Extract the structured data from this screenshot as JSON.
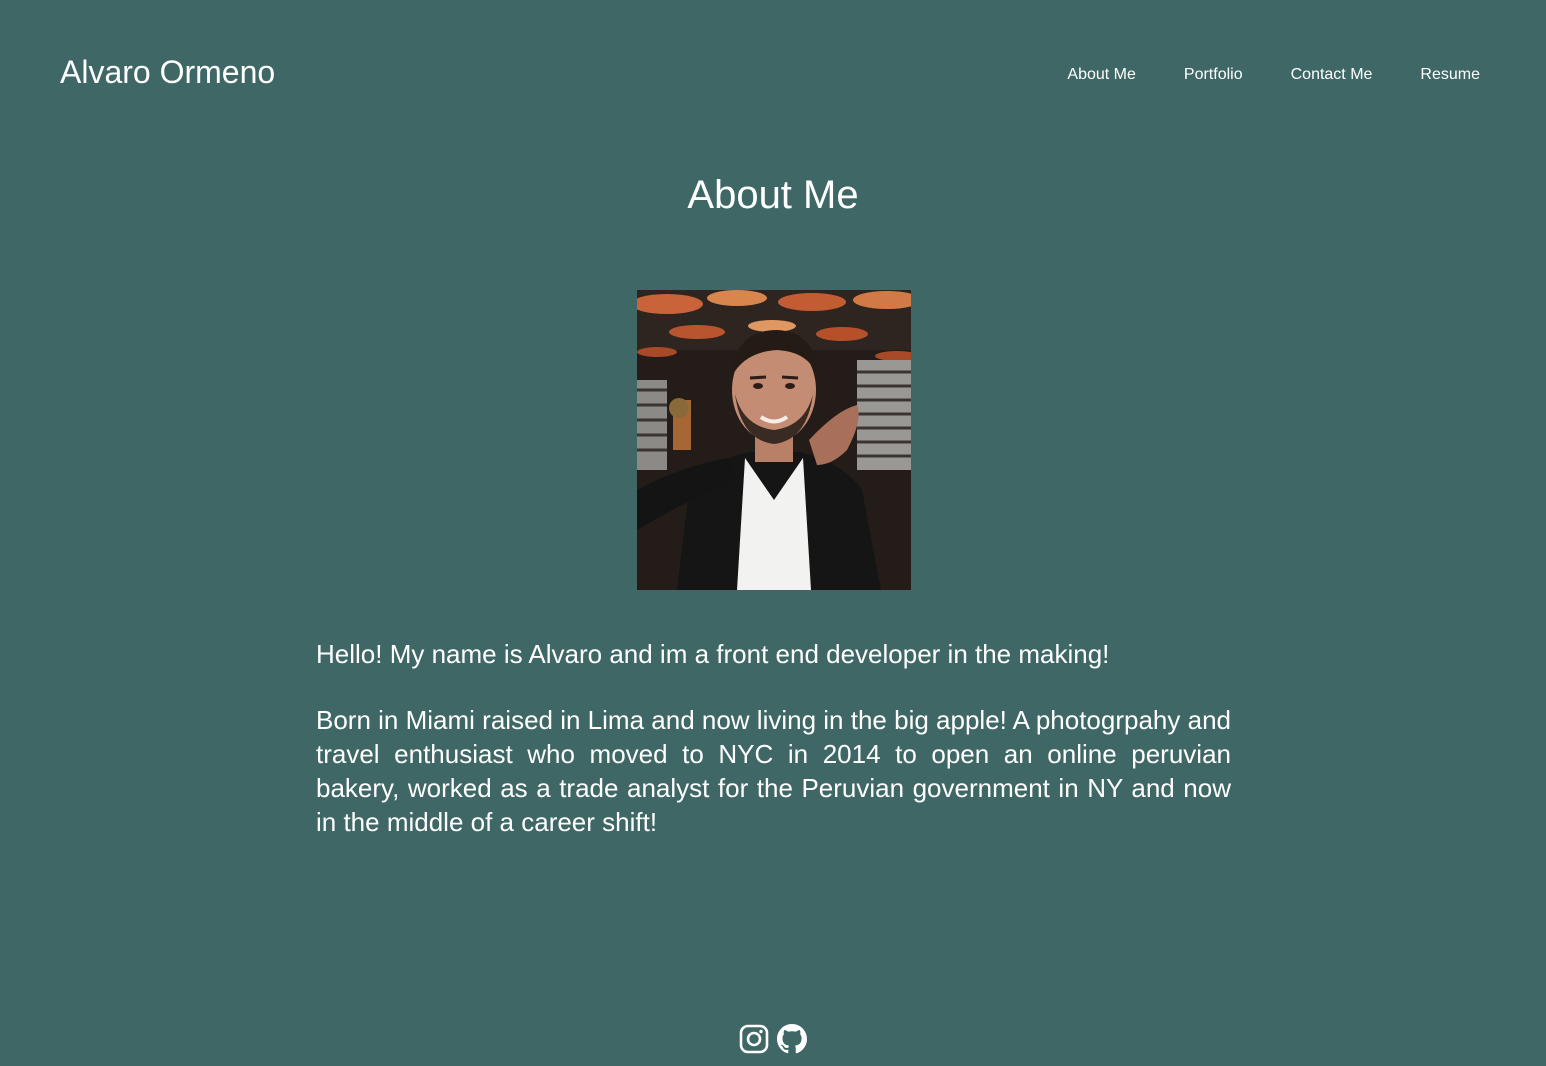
{
  "header": {
    "brand": "Alvaro Ormeno",
    "nav": [
      {
        "label": "About Me"
      },
      {
        "label": "Portfolio"
      },
      {
        "label": "Contact Me"
      },
      {
        "label": "Resume"
      }
    ]
  },
  "main": {
    "title": "About Me",
    "photo": {
      "icon": "profile-photo"
    },
    "paragraphs": [
      "Hello! My name is Alvaro and im a front end developer in the making!",
      "Born in Miami raised in Lima and now living in the big apple! A photogrpahy and travel enthusiast who moved to NYC in 2014 to open an online peruvian bakery, worked as a trade analyst for the Peruvian government in NY and now in the middle of a career shift!"
    ]
  },
  "footer": {
    "icons": [
      "instagram-icon",
      "github-icon"
    ]
  },
  "colors": {
    "background": "#3e6766",
    "text": "#ffffff"
  }
}
